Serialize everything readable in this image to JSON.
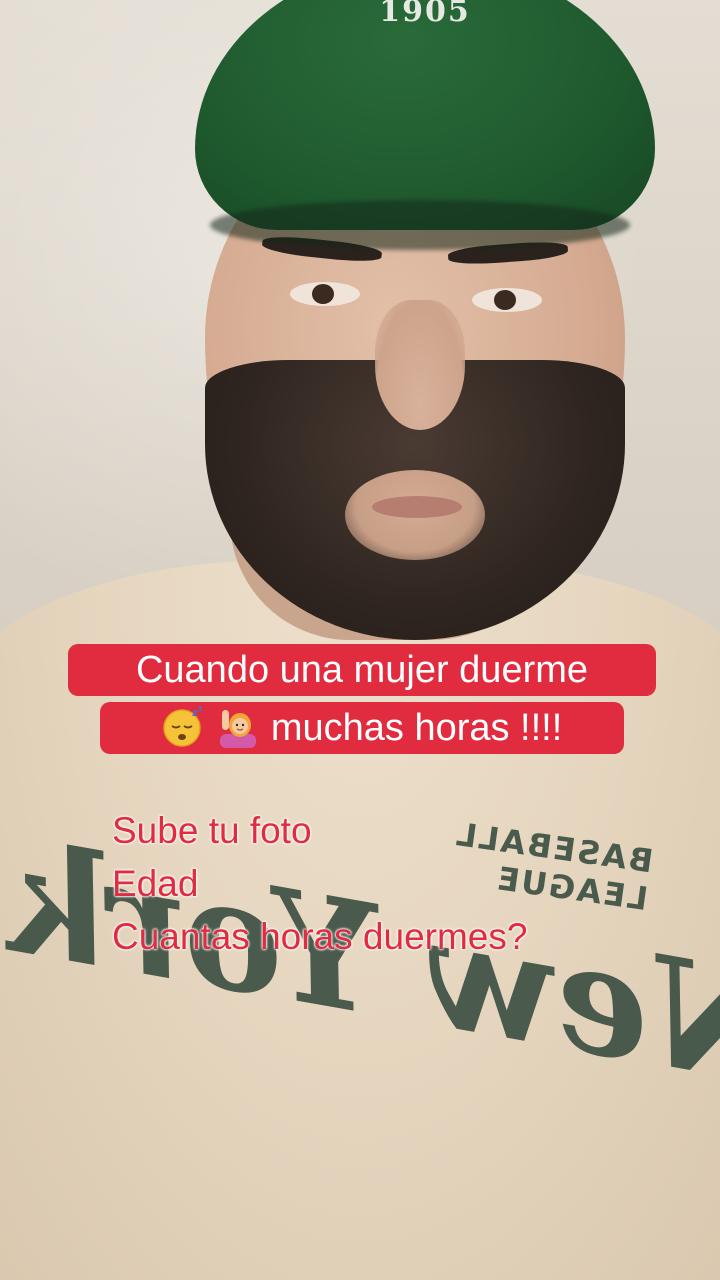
{
  "overlay": {
    "caption_line1": "Cuando una mujer duerme",
    "caption_line2_text": "muchas horas !!!!",
    "caption_emojis": [
      "sleeping-face-icon",
      "person-raising-hand-icon"
    ]
  },
  "text_block": {
    "line1": "Sube tu foto",
    "line2": "Edad",
    "line3": "Cuantas horas duermes?"
  },
  "scene": {
    "cap_text": "1905",
    "shirt_text_small": "BASEBALL LEAGUE",
    "shirt_text_large": "New York"
  },
  "colors": {
    "caption_bg": "#e12b3e",
    "caption_text": "#ffffff",
    "text_red": "#e12b3e",
    "cap_green": "#1f5a2e",
    "shirt": "#e6d6bf"
  }
}
